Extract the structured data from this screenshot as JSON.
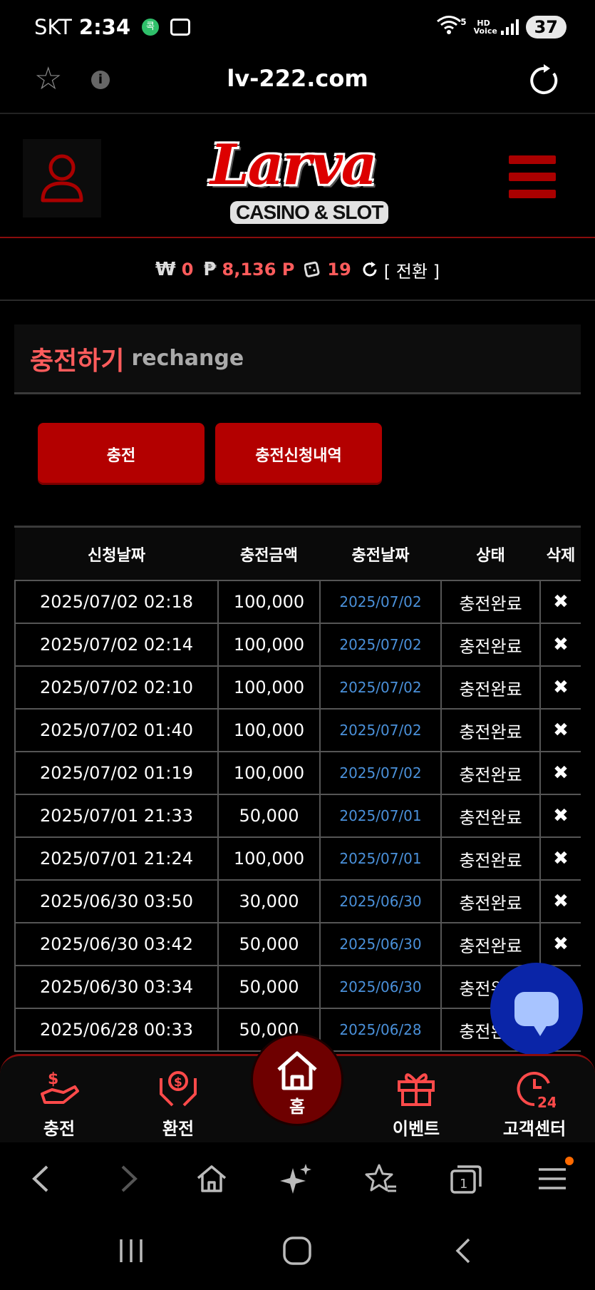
{
  "status_bar": {
    "carrier": "SKT",
    "time": "2:34",
    "app_badge": "콕",
    "network": "5",
    "hd_voice": "HD Voice",
    "battery": "37"
  },
  "browser": {
    "url": "lv-222.com",
    "info_glyph": "i"
  },
  "site": {
    "logo_word": "Larva",
    "logo_sub": "CASINO & SLOT",
    "accent": "#b30000"
  },
  "balance": {
    "won_symbol": "₩",
    "won_value": "0",
    "point_symbol": "₱",
    "point_value": "8,136 P",
    "chip_value": "19",
    "switch_label": "[ 전환 ]"
  },
  "section": {
    "title": "충전하기",
    "subtitle": "rechange"
  },
  "buttons": {
    "charge": "충전",
    "history": "충전신청내역"
  },
  "table": {
    "headers": [
      "신청날짜",
      "충전금액",
      "충전날짜",
      "상태",
      "삭제"
    ],
    "rows": [
      {
        "requested": "2025/07/02 02:18",
        "amount": "100,000",
        "charged": "2025/07/02",
        "status": "충전완료",
        "del": "✖"
      },
      {
        "requested": "2025/07/02 02:14",
        "amount": "100,000",
        "charged": "2025/07/02",
        "status": "충전완료",
        "del": "✖"
      },
      {
        "requested": "2025/07/02 02:10",
        "amount": "100,000",
        "charged": "2025/07/02",
        "status": "충전완료",
        "del": "✖"
      },
      {
        "requested": "2025/07/02 01:40",
        "amount": "100,000",
        "charged": "2025/07/02",
        "status": "충전완료",
        "del": "✖"
      },
      {
        "requested": "2025/07/02 01:19",
        "amount": "100,000",
        "charged": "2025/07/02",
        "status": "충전완료",
        "del": "✖"
      },
      {
        "requested": "2025/07/01 21:33",
        "amount": "50,000",
        "charged": "2025/07/01",
        "status": "충전완료",
        "del": "✖"
      },
      {
        "requested": "2025/07/01 21:24",
        "amount": "100,000",
        "charged": "2025/07/01",
        "status": "충전완료",
        "del": "✖"
      },
      {
        "requested": "2025/06/30 03:50",
        "amount": "30,000",
        "charged": "2025/06/30",
        "status": "충전완료",
        "del": "✖"
      },
      {
        "requested": "2025/06/30 03:42",
        "amount": "50,000",
        "charged": "2025/06/30",
        "status": "충전완료",
        "del": "✖"
      },
      {
        "requested": "2025/06/30 03:34",
        "amount": "50,000",
        "charged": "2025/06/30",
        "status": "충전완료",
        "del": "✖"
      },
      {
        "requested": "2025/06/28 00:33",
        "amount": "50,000",
        "charged": "2025/06/28",
        "status": "충전완료",
        "del": "✖"
      }
    ]
  },
  "site_nav": {
    "charge": "충전",
    "exchange": "환전",
    "home": "홈",
    "event": "이벤트",
    "support": "고객센터"
  },
  "colors": {
    "red_text": "#ff5c5c",
    "date_blue": "#4a90d9",
    "chat_blue": "#0a25a8"
  }
}
